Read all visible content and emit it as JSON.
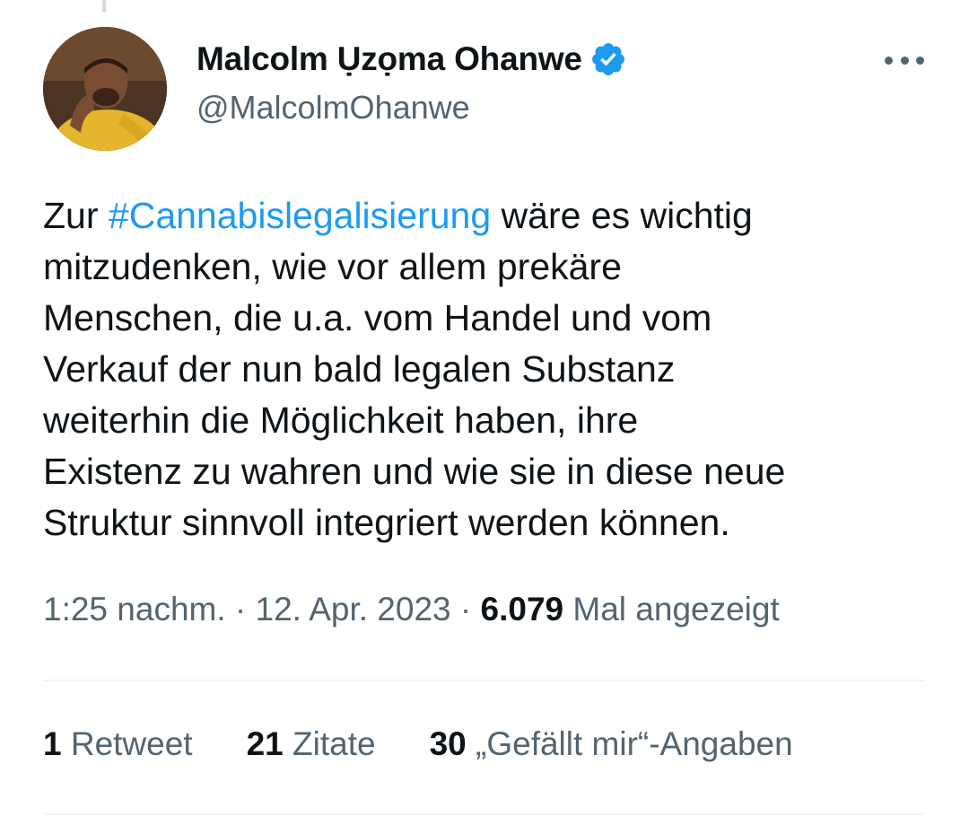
{
  "tweet": {
    "author": {
      "display_name": "Malcolm Ụzọma Ohanwe",
      "handle": "@MalcolmOhanwe",
      "verified": true
    },
    "text": {
      "line1_prefix": "Zur ",
      "hashtag": "#Cannabislegalisierung",
      "line1_suffix": " wäre es wichtig",
      "line2": "mitzudenken, wie vor allem prekäre",
      "line3": "Menschen, die u.a. vom Handel und vom",
      "line4": "Verkauf der nun bald legalen Substanz",
      "line5": "weiterhin die Möglichkeit haben, ihre",
      "line6": "Existenz zu wahren und wie sie in diese neue",
      "line7": "Struktur sinnvoll integriert werden können."
    },
    "meta": {
      "time": "1:25 nachm.",
      "separator": " · ",
      "date": "12. Apr. 2023",
      "views_count": "6.079",
      "views_label": " Mal angezeigt"
    },
    "stats": {
      "retweets_count": "1",
      "retweets_label": " Retweet",
      "quotes_count": "21",
      "quotes_label": " Zitate",
      "likes_count": "30",
      "likes_label": " „Gefällt mir“-Angaben"
    }
  },
  "icons": {
    "verified": "verified-badge-icon",
    "more": "more-options-icon"
  },
  "colors": {
    "accent": "#1d9bf0",
    "text_primary": "#0f1419",
    "text_secondary": "#536471",
    "divider": "#eff3f4",
    "avatar_shirt": "#e5b62c"
  }
}
